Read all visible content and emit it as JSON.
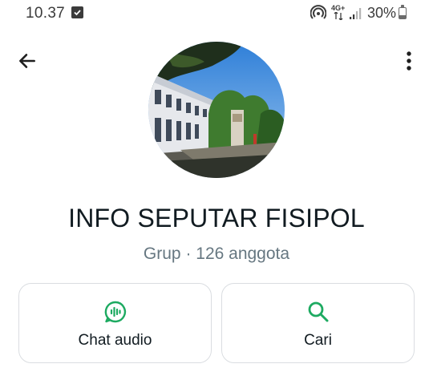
{
  "status_bar": {
    "time": "10.37",
    "network": "4G+",
    "battery": "30%",
    "battery_level": 0.3
  },
  "header": {
    "back_icon": "arrow-left-icon",
    "menu_icon": "more-vertical-icon"
  },
  "group": {
    "name": "INFO SEPUTAR FISIPOL",
    "meta": "Grup · 126 anggota"
  },
  "actions": [
    {
      "label": "Chat audio",
      "icon": "audio-chat-icon"
    },
    {
      "label": "Cari",
      "icon": "search-icon"
    }
  ],
  "colors": {
    "accent": "#1daa61",
    "text_primary": "#111b21",
    "text_secondary": "#667781",
    "card_border": "#dadde1"
  }
}
